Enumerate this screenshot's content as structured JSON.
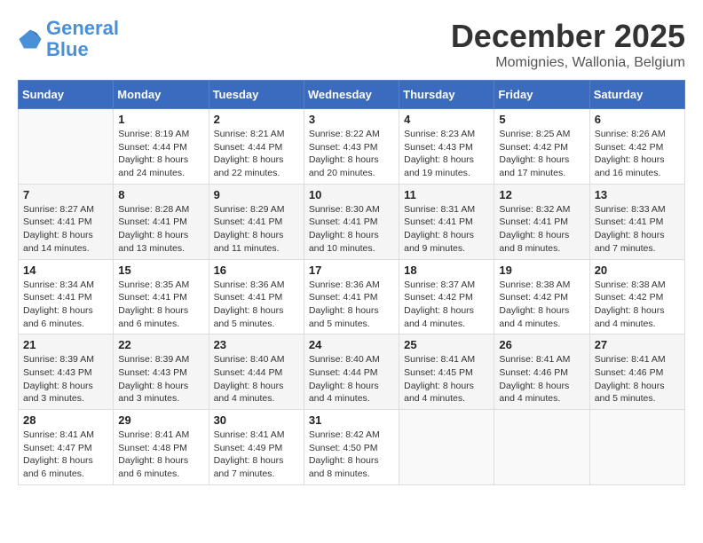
{
  "header": {
    "logo_line1": "General",
    "logo_line2": "Blue",
    "month": "December 2025",
    "location": "Momignies, Wallonia, Belgium"
  },
  "weekdays": [
    "Sunday",
    "Monday",
    "Tuesday",
    "Wednesday",
    "Thursday",
    "Friday",
    "Saturday"
  ],
  "weeks": [
    [
      {
        "day": "",
        "sunrise": "",
        "sunset": "",
        "daylight": ""
      },
      {
        "day": "1",
        "sunrise": "Sunrise: 8:19 AM",
        "sunset": "Sunset: 4:44 PM",
        "daylight": "Daylight: 8 hours and 24 minutes."
      },
      {
        "day": "2",
        "sunrise": "Sunrise: 8:21 AM",
        "sunset": "Sunset: 4:44 PM",
        "daylight": "Daylight: 8 hours and 22 minutes."
      },
      {
        "day": "3",
        "sunrise": "Sunrise: 8:22 AM",
        "sunset": "Sunset: 4:43 PM",
        "daylight": "Daylight: 8 hours and 20 minutes."
      },
      {
        "day": "4",
        "sunrise": "Sunrise: 8:23 AM",
        "sunset": "Sunset: 4:43 PM",
        "daylight": "Daylight: 8 hours and 19 minutes."
      },
      {
        "day": "5",
        "sunrise": "Sunrise: 8:25 AM",
        "sunset": "Sunset: 4:42 PM",
        "daylight": "Daylight: 8 hours and 17 minutes."
      },
      {
        "day": "6",
        "sunrise": "Sunrise: 8:26 AM",
        "sunset": "Sunset: 4:42 PM",
        "daylight": "Daylight: 8 hours and 16 minutes."
      }
    ],
    [
      {
        "day": "7",
        "sunrise": "Sunrise: 8:27 AM",
        "sunset": "Sunset: 4:41 PM",
        "daylight": "Daylight: 8 hours and 14 minutes."
      },
      {
        "day": "8",
        "sunrise": "Sunrise: 8:28 AM",
        "sunset": "Sunset: 4:41 PM",
        "daylight": "Daylight: 8 hours and 13 minutes."
      },
      {
        "day": "9",
        "sunrise": "Sunrise: 8:29 AM",
        "sunset": "Sunset: 4:41 PM",
        "daylight": "Daylight: 8 hours and 11 minutes."
      },
      {
        "day": "10",
        "sunrise": "Sunrise: 8:30 AM",
        "sunset": "Sunset: 4:41 PM",
        "daylight": "Daylight: 8 hours and 10 minutes."
      },
      {
        "day": "11",
        "sunrise": "Sunrise: 8:31 AM",
        "sunset": "Sunset: 4:41 PM",
        "daylight": "Daylight: 8 hours and 9 minutes."
      },
      {
        "day": "12",
        "sunrise": "Sunrise: 8:32 AM",
        "sunset": "Sunset: 4:41 PM",
        "daylight": "Daylight: 8 hours and 8 minutes."
      },
      {
        "day": "13",
        "sunrise": "Sunrise: 8:33 AM",
        "sunset": "Sunset: 4:41 PM",
        "daylight": "Daylight: 8 hours and 7 minutes."
      }
    ],
    [
      {
        "day": "14",
        "sunrise": "Sunrise: 8:34 AM",
        "sunset": "Sunset: 4:41 PM",
        "daylight": "Daylight: 8 hours and 6 minutes."
      },
      {
        "day": "15",
        "sunrise": "Sunrise: 8:35 AM",
        "sunset": "Sunset: 4:41 PM",
        "daylight": "Daylight: 8 hours and 6 minutes."
      },
      {
        "day": "16",
        "sunrise": "Sunrise: 8:36 AM",
        "sunset": "Sunset: 4:41 PM",
        "daylight": "Daylight: 8 hours and 5 minutes."
      },
      {
        "day": "17",
        "sunrise": "Sunrise: 8:36 AM",
        "sunset": "Sunset: 4:41 PM",
        "daylight": "Daylight: 8 hours and 5 minutes."
      },
      {
        "day": "18",
        "sunrise": "Sunrise: 8:37 AM",
        "sunset": "Sunset: 4:42 PM",
        "daylight": "Daylight: 8 hours and 4 minutes."
      },
      {
        "day": "19",
        "sunrise": "Sunrise: 8:38 AM",
        "sunset": "Sunset: 4:42 PM",
        "daylight": "Daylight: 8 hours and 4 minutes."
      },
      {
        "day": "20",
        "sunrise": "Sunrise: 8:38 AM",
        "sunset": "Sunset: 4:42 PM",
        "daylight": "Daylight: 8 hours and 4 minutes."
      }
    ],
    [
      {
        "day": "21",
        "sunrise": "Sunrise: 8:39 AM",
        "sunset": "Sunset: 4:43 PM",
        "daylight": "Daylight: 8 hours and 3 minutes."
      },
      {
        "day": "22",
        "sunrise": "Sunrise: 8:39 AM",
        "sunset": "Sunset: 4:43 PM",
        "daylight": "Daylight: 8 hours and 3 minutes."
      },
      {
        "day": "23",
        "sunrise": "Sunrise: 8:40 AM",
        "sunset": "Sunset: 4:44 PM",
        "daylight": "Daylight: 8 hours and 4 minutes."
      },
      {
        "day": "24",
        "sunrise": "Sunrise: 8:40 AM",
        "sunset": "Sunset: 4:44 PM",
        "daylight": "Daylight: 8 hours and 4 minutes."
      },
      {
        "day": "25",
        "sunrise": "Sunrise: 8:41 AM",
        "sunset": "Sunset: 4:45 PM",
        "daylight": "Daylight: 8 hours and 4 minutes."
      },
      {
        "day": "26",
        "sunrise": "Sunrise: 8:41 AM",
        "sunset": "Sunset: 4:46 PM",
        "daylight": "Daylight: 8 hours and 4 minutes."
      },
      {
        "day": "27",
        "sunrise": "Sunrise: 8:41 AM",
        "sunset": "Sunset: 4:46 PM",
        "daylight": "Daylight: 8 hours and 5 minutes."
      }
    ],
    [
      {
        "day": "28",
        "sunrise": "Sunrise: 8:41 AM",
        "sunset": "Sunset: 4:47 PM",
        "daylight": "Daylight: 8 hours and 6 minutes."
      },
      {
        "day": "29",
        "sunrise": "Sunrise: 8:41 AM",
        "sunset": "Sunset: 4:48 PM",
        "daylight": "Daylight: 8 hours and 6 minutes."
      },
      {
        "day": "30",
        "sunrise": "Sunrise: 8:41 AM",
        "sunset": "Sunset: 4:49 PM",
        "daylight": "Daylight: 8 hours and 7 minutes."
      },
      {
        "day": "31",
        "sunrise": "Sunrise: 8:42 AM",
        "sunset": "Sunset: 4:50 PM",
        "daylight": "Daylight: 8 hours and 8 minutes."
      },
      {
        "day": "",
        "sunrise": "",
        "sunset": "",
        "daylight": ""
      },
      {
        "day": "",
        "sunrise": "",
        "sunset": "",
        "daylight": ""
      },
      {
        "day": "",
        "sunrise": "",
        "sunset": "",
        "daylight": ""
      }
    ]
  ]
}
